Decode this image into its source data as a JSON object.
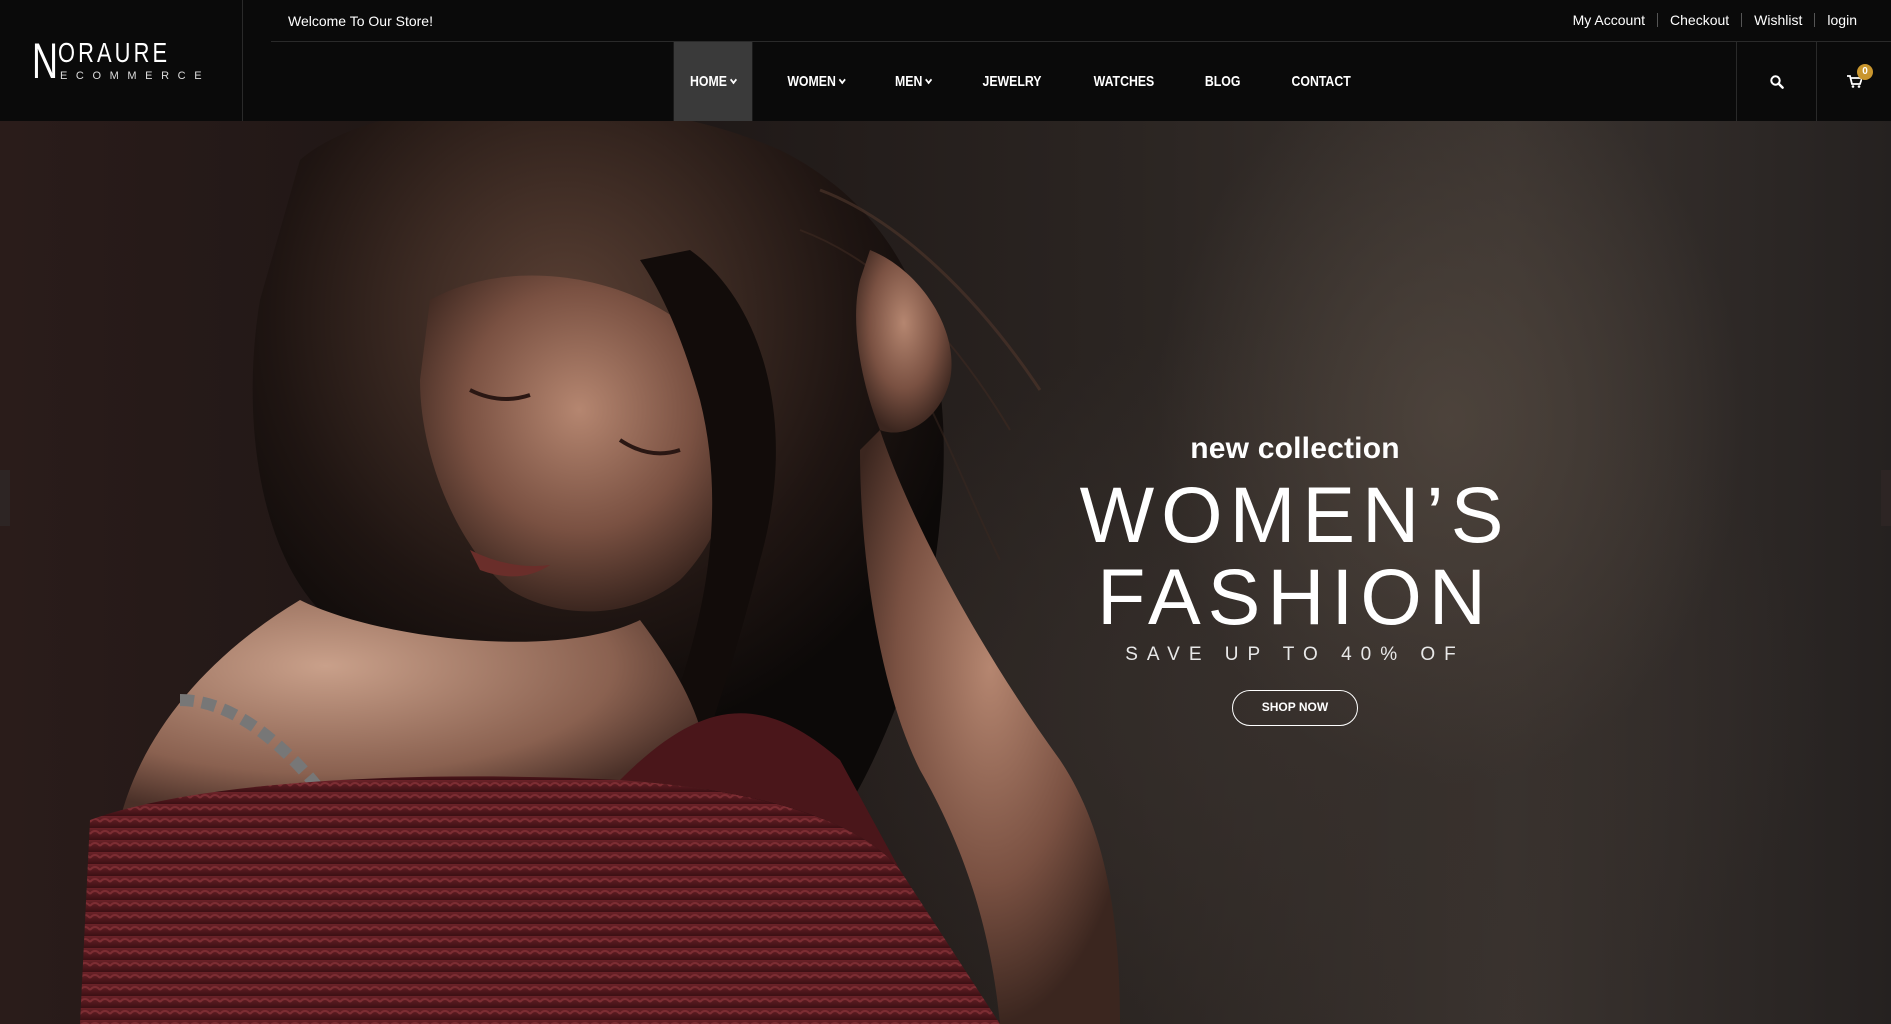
{
  "logo": {
    "initial": "N",
    "name": "ORAURE",
    "tagline": "ECOMMERCE"
  },
  "topbar": {
    "welcome": "Welcome To Our Store!",
    "links": [
      "My Account",
      "Checkout",
      "Wishlist",
      "login"
    ]
  },
  "nav": {
    "items": [
      {
        "label": "HOME",
        "dropdown": true,
        "active": true
      },
      {
        "label": "WOMEN",
        "dropdown": true
      },
      {
        "label": "MEN",
        "dropdown": true
      },
      {
        "label": "JEWELRY"
      },
      {
        "label": "WATCHES"
      },
      {
        "label": "BLOG"
      },
      {
        "label": "CONTACT"
      }
    ]
  },
  "actions": {
    "search_icon": "search-icon",
    "cart_icon": "cart-icon",
    "cart_count": "0"
  },
  "hero": {
    "kicker": "new collection",
    "headline": "WOMEN’S FASHION",
    "subline": "SAVE UP TO 40% OF",
    "cta": "SHOP NOW"
  },
  "colors": {
    "accent": "#c9962e",
    "header_bg": "#0a0a0a",
    "sweater": "#5a1a1e"
  }
}
